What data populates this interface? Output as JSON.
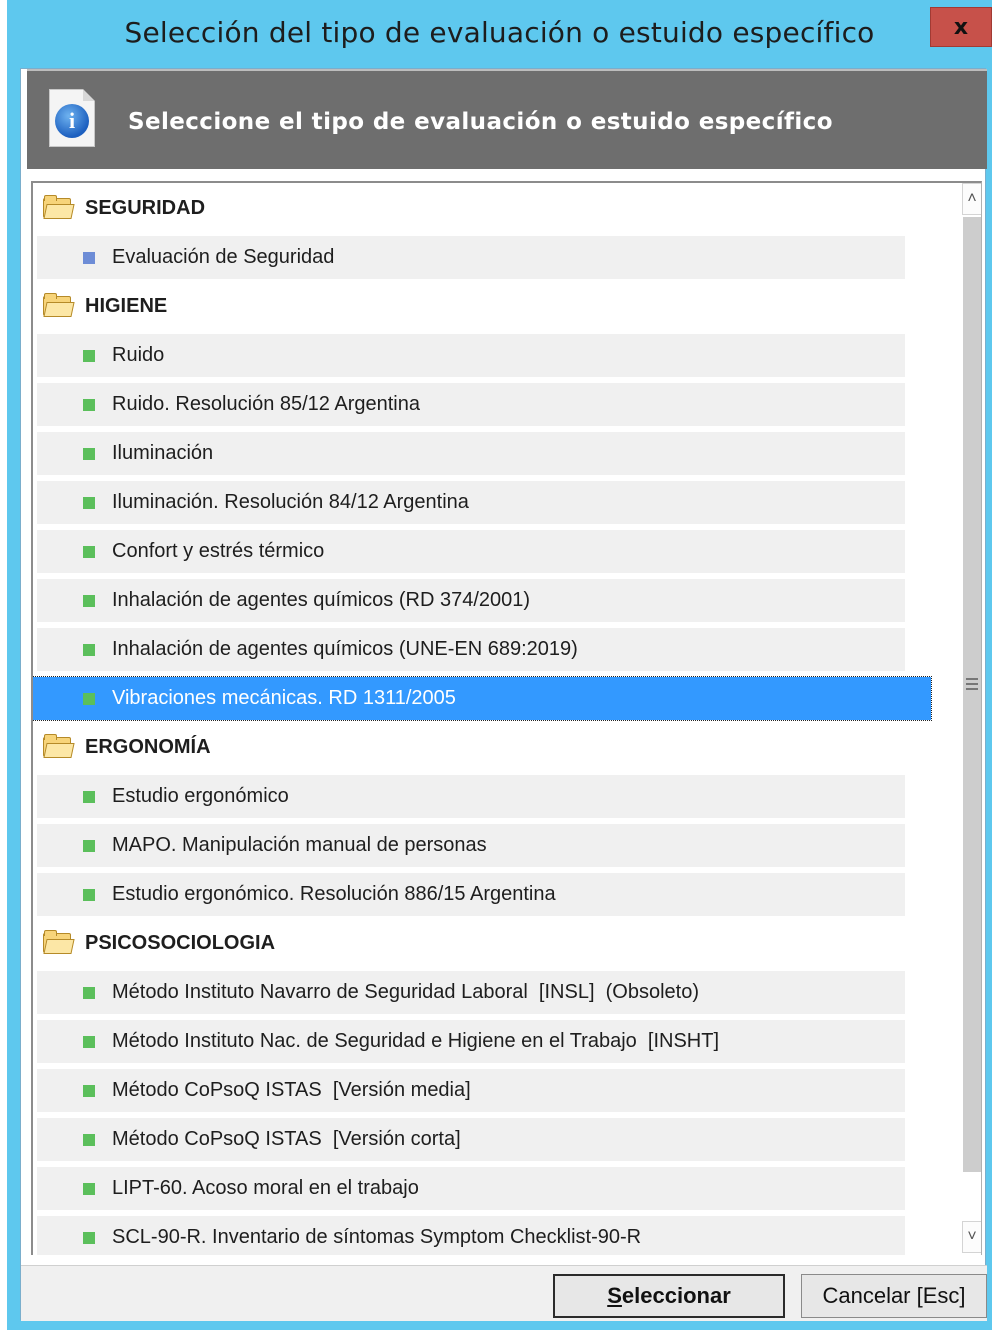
{
  "window": {
    "title": "Selección del tipo de evaluación o estuido específico",
    "close_label": "x"
  },
  "header": {
    "icon": "info-icon",
    "text": "Seleccione el tipo de evaluación o estuido específico"
  },
  "list": {
    "selected_index": 10,
    "rows": [
      {
        "type": "category",
        "label": "SEGURIDAD"
      },
      {
        "type": "item",
        "bullet": "blue",
        "label": "Evaluación de Seguridad"
      },
      {
        "type": "category",
        "label": "HIGIENE"
      },
      {
        "type": "item",
        "bullet": "green",
        "label": "Ruido"
      },
      {
        "type": "item",
        "bullet": "green",
        "label": "Ruido. Resolución 85/12 Argentina"
      },
      {
        "type": "item",
        "bullet": "green",
        "label": "Iluminación"
      },
      {
        "type": "item",
        "bullet": "green",
        "label": "Iluminación. Resolución 84/12 Argentina"
      },
      {
        "type": "item",
        "bullet": "green",
        "label": "Confort y estrés térmico"
      },
      {
        "type": "item",
        "bullet": "green",
        "label": "Inhalación de agentes químicos (RD 374/2001)"
      },
      {
        "type": "item",
        "bullet": "green",
        "label": "Inhalación de agentes químicos (UNE-EN 689:2019)"
      },
      {
        "type": "item",
        "bullet": "green",
        "label": "Vibraciones mecánicas. RD 1311/2005"
      },
      {
        "type": "category",
        "label": "ERGONOMÍA"
      },
      {
        "type": "item",
        "bullet": "green",
        "label": "Estudio ergonómico"
      },
      {
        "type": "item",
        "bullet": "green",
        "label": "MAPO. Manipulación manual de personas"
      },
      {
        "type": "item",
        "bullet": "green",
        "label": "Estudio ergonómico. Resolución 886/15 Argentina"
      },
      {
        "type": "category",
        "label": "PSICOSOCIOLOGIA"
      },
      {
        "type": "item",
        "bullet": "green",
        "label": "Método Instituto Navarro de Seguridad Laboral  [INSL]  (Obsoleto)"
      },
      {
        "type": "item",
        "bullet": "green",
        "label": "Método Instituto Nac. de Seguridad e Higiene en el Trabajo  [INSHT]"
      },
      {
        "type": "item",
        "bullet": "green",
        "label": "Método CoPsoQ ISTAS  [Versión media]"
      },
      {
        "type": "item",
        "bullet": "green",
        "label": "Método CoPsoQ ISTAS  [Versión corta]"
      },
      {
        "type": "item",
        "bullet": "green",
        "label": "LIPT-60. Acoso moral en el trabajo"
      },
      {
        "type": "item",
        "bullet": "green",
        "label": "SCL-90-R. Inventario de síntomas Symptom Checklist-90-R"
      }
    ]
  },
  "buttons": {
    "select_mnemonic": "S",
    "select_rest": "eleccionar",
    "cancel": "Cancelar  [Esc]"
  },
  "colors": {
    "title_bar": "#5ec8ee",
    "header_bg": "#6e6e6e",
    "selection": "#3399ff",
    "bullet_green": "#5bbf5b",
    "bullet_blue": "#6d8cd6"
  }
}
